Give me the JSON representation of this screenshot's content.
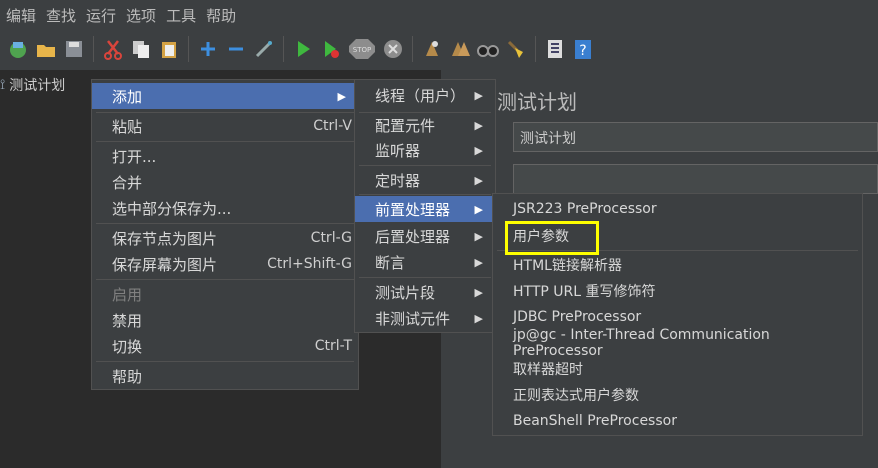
{
  "menubar": [
    "编辑",
    "查找",
    "运行",
    "选项",
    "工具",
    "帮助"
  ],
  "toolbar": [
    "open-icon",
    "folder-icon",
    "save-icon",
    "cut-icon",
    "copy-icon",
    "paste-icon",
    "plus-icon",
    "minus-icon",
    "wand-icon",
    "start-icon",
    "start-no-pause-icon",
    "stop-icon",
    "shutdown-icon",
    "clear-icon",
    "clear-all-icon",
    "search-icon",
    "broom-icon",
    "list-icon",
    "help-icon"
  ],
  "tree": {
    "root": "测试计划"
  },
  "right_panel": {
    "title": "测试计划",
    "name_value": "测试计划",
    "comment_value": ""
  },
  "context_menu": {
    "items": [
      {
        "label": "添加",
        "arrow": "▶",
        "shortcut": ""
      },
      {
        "label": "粘贴",
        "arrow": "",
        "shortcut": "Ctrl-V"
      },
      {
        "label": "打开...",
        "arrow": "",
        "shortcut": ""
      },
      {
        "label": "合并",
        "arrow": "",
        "shortcut": ""
      },
      {
        "label": "选中部分保存为...",
        "arrow": "",
        "shortcut": ""
      },
      {
        "label": "保存节点为图片",
        "arrow": "",
        "shortcut": "Ctrl-G"
      },
      {
        "label": "保存屏幕为图片",
        "arrow": "",
        "shortcut": "Ctrl+Shift-G"
      },
      {
        "label": "启用",
        "arrow": "",
        "shortcut": ""
      },
      {
        "label": "禁用",
        "arrow": "",
        "shortcut": ""
      },
      {
        "label": "切换",
        "arrow": "",
        "shortcut": "Ctrl-T"
      },
      {
        "label": "帮助",
        "arrow": "",
        "shortcut": ""
      }
    ]
  },
  "add_submenu": {
    "items": [
      {
        "label": "线程（用户）",
        "arrow": "▶"
      },
      {
        "label": "配置元件",
        "arrow": "▶"
      },
      {
        "label": "监听器",
        "arrow": "▶"
      },
      {
        "label": "定时器",
        "arrow": "▶"
      },
      {
        "label": "前置处理器",
        "arrow": "▶"
      },
      {
        "label": "后置处理器",
        "arrow": "▶"
      },
      {
        "label": "断言",
        "arrow": "▶"
      },
      {
        "label": "测试片段",
        "arrow": "▶"
      },
      {
        "label": "非测试元件",
        "arrow": "▶"
      }
    ]
  },
  "preprocessor_submenu": {
    "items": [
      "JSR223 PreProcessor",
      "用户参数",
      "HTML链接解析器",
      "HTTP URL 重写修饰符",
      "JDBC PreProcessor",
      "jp@gc - Inter-Thread Communication PreProcessor",
      "取样器超时",
      "正则表达式用户参数",
      "BeanShell PreProcessor"
    ]
  },
  "colors": {
    "selection": "#4b6eaf",
    "highlight_box": "#ffff00",
    "background": "#3c3f41"
  }
}
